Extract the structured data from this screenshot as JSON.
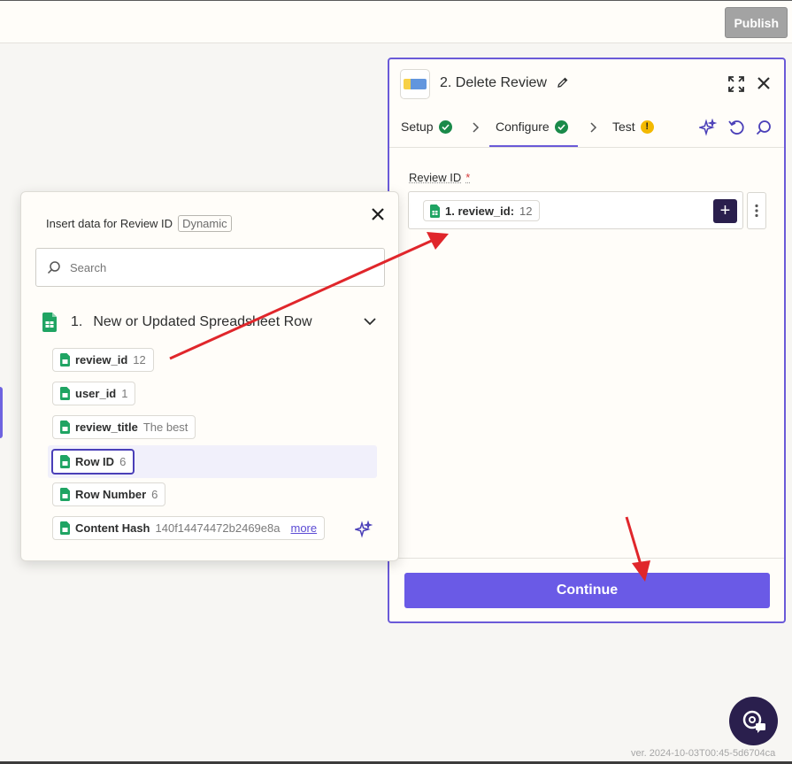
{
  "topbar": {
    "publish_label": "Publish"
  },
  "panel": {
    "step_title": "2. Delete Review",
    "tabs": [
      {
        "label": "Setup",
        "status": "ok"
      },
      {
        "label": "Configure",
        "status": "ok"
      },
      {
        "label": "Test",
        "status": "warning",
        "status_glyph": "!"
      }
    ],
    "field": {
      "label": "Review ID",
      "required_mark": "*",
      "pill_key": "1. review_id:",
      "pill_value": "12",
      "plus_glyph": "+"
    },
    "continue_label": "Continue"
  },
  "popover": {
    "title": "Insert data for Review ID",
    "tag": "Dynamic",
    "search_placeholder": "Search",
    "group": {
      "number": "1.",
      "name": "New or Updated Spreadsheet Row"
    },
    "items": [
      {
        "key": "review_id",
        "value": "12"
      },
      {
        "key": "user_id",
        "value": "1"
      },
      {
        "key": "review_title",
        "value": "The best"
      },
      {
        "key": "Row ID",
        "value": "6"
      },
      {
        "key": "Row Number",
        "value": "6"
      },
      {
        "key": "Content Hash",
        "value": "140f14474472b2469e8a",
        "more": "more"
      }
    ]
  },
  "footer": {
    "version": "ver. 2024-10-03T00:45-5d6704ca"
  },
  "colors": {
    "accent": "#6a5ae6",
    "ok": "#1a8a4a",
    "warning": "#f3b900",
    "annotation_arrow": "#e0262b"
  }
}
